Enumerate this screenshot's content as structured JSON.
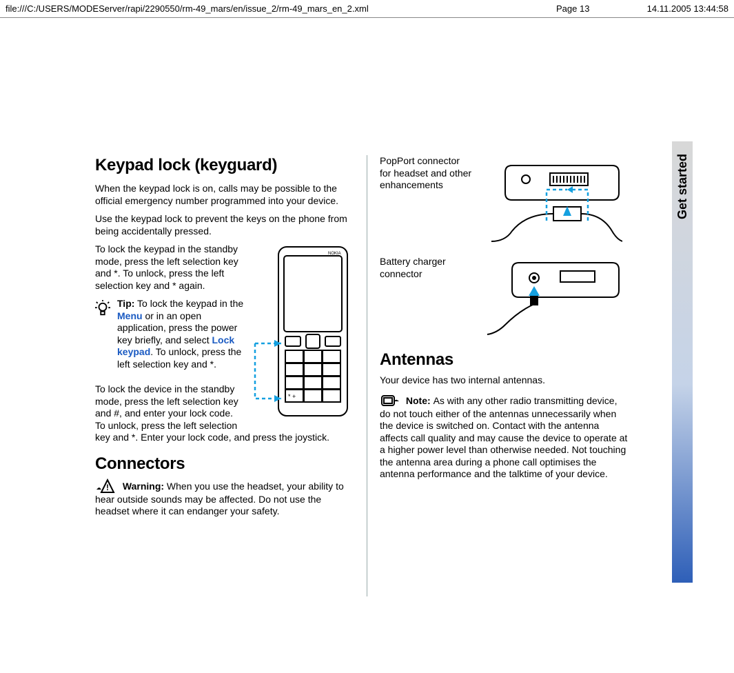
{
  "header": {
    "file_path": "file:///C:/USERS/MODEServer/rapi/2290550/rm-49_mars/en/issue_2/rm-49_mars_en_2.xml",
    "page_label": "Page 13",
    "timestamp": "14.11.2005 13:44:58"
  },
  "side_tab": "Get started",
  "page_number": "13",
  "left": {
    "h1": "Keypad lock (keyguard)",
    "p1": "When the keypad lock is on, calls may be possible to the official emergency number programmed into your device.",
    "p2": "Use the keypad lock to prevent the keys on the phone from being accidentally pressed.",
    "p3": "To lock the keypad in the standby mode, press the left selection key and *. To unlock, press the left selection key and * again.",
    "tip_label": "Tip:",
    "tip_a": " To lock the keypad in the ",
    "menu_word": "Menu",
    "tip_b": " or in an open application, press the power key briefly, and select ",
    "lock_keypad_word": "Lock keypad",
    "tip_c": ". To unlock, press the left selection key and *.",
    "p4": "To lock the device in the standby mode, press the left selection key and #, and enter your lock code. To unlock, press the left selection key and *. Enter your lock code, and press the joystick.",
    "h2": "Connectors",
    "warn_label": "Warning: ",
    "warn_text": " When you use the headset, your ability to hear outside sounds may be affected. Do not use the headset where it can endanger your safety."
  },
  "right": {
    "conn1_label": "PopPort connector for headset and other enhancements",
    "conn2_label": "Battery charger connector",
    "h2": "Antennas",
    "p1": "Your device has two internal antennas.",
    "note_label": "Note: ",
    "note_text": " As with any other radio transmitting device, do not touch either of the antennas unnecessarily when the device is switched on. Contact with the antenna affects call quality and may cause the device to operate at a higher power level than otherwise needed. Not touching the antenna area during a phone call optimises the antenna performance and the talktime of your device."
  }
}
